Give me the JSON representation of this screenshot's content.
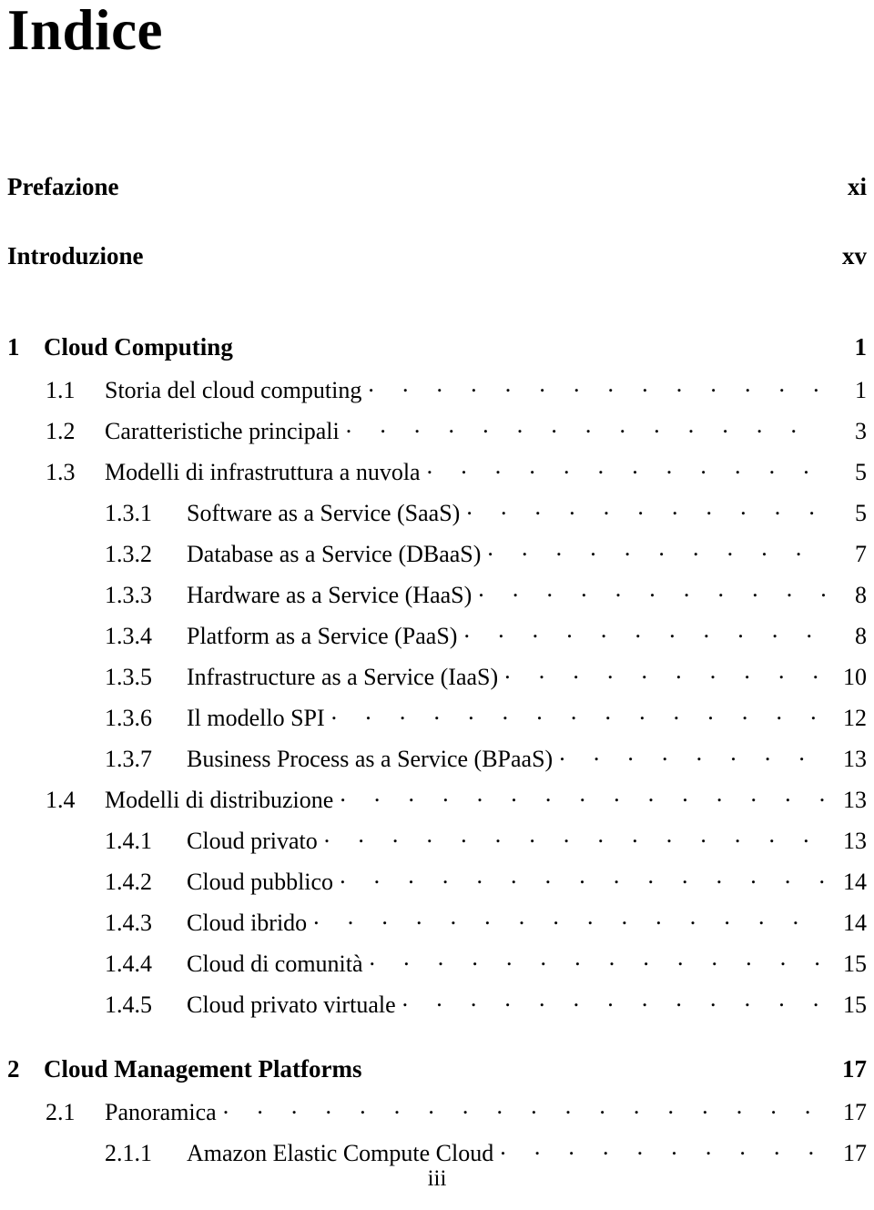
{
  "document": {
    "title": "Indice",
    "folio": "iii"
  },
  "front_matter": [
    {
      "label": "Prefazione",
      "page": "xi"
    },
    {
      "label": "Introduzione",
      "page": "xv"
    }
  ],
  "entries": [
    {
      "level": "chapter",
      "number": "1",
      "label": "Cloud Computing",
      "page": "1",
      "leader": false,
      "gap": true
    },
    {
      "level": "section",
      "number": "1.1",
      "label": "Storia del cloud computing",
      "page": "1",
      "leader": true,
      "gap": false
    },
    {
      "level": "section",
      "number": "1.2",
      "label": "Caratteristiche principali",
      "page": "3",
      "leader": true,
      "gap": false
    },
    {
      "level": "section",
      "number": "1.3",
      "label": "Modelli di infrastruttura a nuvola",
      "page": "5",
      "leader": true,
      "gap": false
    },
    {
      "level": "subsection",
      "number": "1.3.1",
      "label": "Software as a Service (SaaS)",
      "page": "5",
      "leader": true,
      "gap": false
    },
    {
      "level": "subsection",
      "number": "1.3.2",
      "label": "Database as a Service (DBaaS)",
      "page": "7",
      "leader": true,
      "gap": false
    },
    {
      "level": "subsection",
      "number": "1.3.3",
      "label": "Hardware as a Service (HaaS)",
      "page": "8",
      "leader": true,
      "gap": false
    },
    {
      "level": "subsection",
      "number": "1.3.4",
      "label": "Platform as a Service (PaaS)",
      "page": "8",
      "leader": true,
      "gap": false
    },
    {
      "level": "subsection",
      "number": "1.3.5",
      "label": "Infrastructure as a Service (IaaS)",
      "page": "10",
      "leader": true,
      "gap": false
    },
    {
      "level": "subsection",
      "number": "1.3.6",
      "label": "Il modello SPI",
      "page": "12",
      "leader": true,
      "gap": false
    },
    {
      "level": "subsection",
      "number": "1.3.7",
      "label": "Business Process as a Service (BPaaS)",
      "page": "13",
      "leader": true,
      "gap": false
    },
    {
      "level": "section",
      "number": "1.4",
      "label": "Modelli di distribuzione",
      "page": "13",
      "leader": true,
      "gap": false
    },
    {
      "level": "subsection",
      "number": "1.4.1",
      "label": "Cloud privato",
      "page": "13",
      "leader": true,
      "gap": false
    },
    {
      "level": "subsection",
      "number": "1.4.2",
      "label": "Cloud pubblico",
      "page": "14",
      "leader": true,
      "gap": false
    },
    {
      "level": "subsection",
      "number": "1.4.3",
      "label": "Cloud ibrido",
      "page": "14",
      "leader": true,
      "gap": false
    },
    {
      "level": "subsection",
      "number": "1.4.4",
      "label": "Cloud di comunità",
      "page": "15",
      "leader": true,
      "gap": false
    },
    {
      "level": "subsection",
      "number": "1.4.5",
      "label": "Cloud privato virtuale",
      "page": "15",
      "leader": true,
      "gap": false
    },
    {
      "level": "chapter",
      "number": "2",
      "label": "Cloud Management Platforms",
      "page": "17",
      "leader": false,
      "gap": true
    },
    {
      "level": "section",
      "number": "2.1",
      "label": "Panoramica",
      "page": "17",
      "leader": true,
      "gap": false
    },
    {
      "level": "subsection",
      "number": "2.1.1",
      "label": "Amazon Elastic Compute Cloud",
      "page": "17",
      "leader": true,
      "gap": false
    }
  ]
}
